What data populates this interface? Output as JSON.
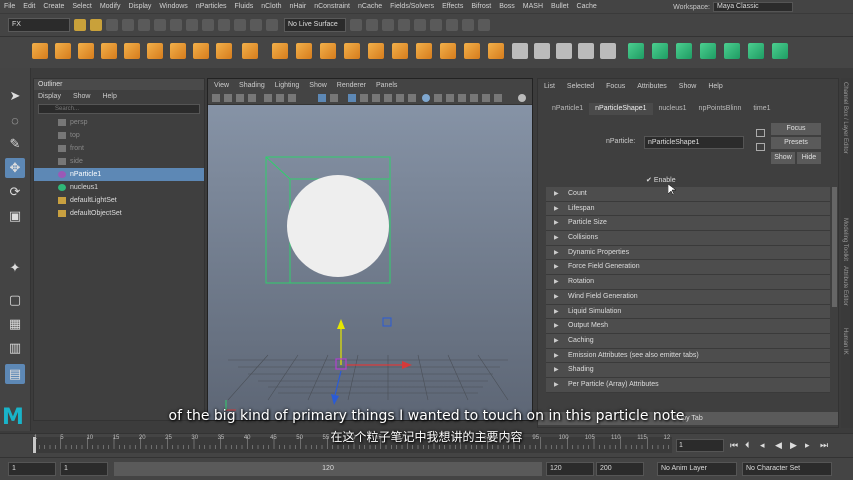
{
  "menubar": {
    "items": [
      "File",
      "Edit",
      "Create",
      "Select",
      "Modify",
      "Display",
      "Windows",
      "nParticles",
      "Fluids",
      "nCloth",
      "nHair",
      "nConstraint",
      "nCache",
      "Fields/Solvers",
      "Effects",
      "Bifrost",
      "Boss",
      "MASH",
      "Bullet",
      "Cache"
    ],
    "workspace_label": "Workspace:",
    "workspace_value": "Maya Classic"
  },
  "statusline": {
    "mode": "FX",
    "live_surface": "No Live Surface"
  },
  "outliner": {
    "title": "Outliner",
    "menu": [
      "Display",
      "Show",
      "Help"
    ],
    "search_placeholder": "Search...",
    "items": [
      {
        "label": "persp",
        "state": "dim"
      },
      {
        "label": "top",
        "state": "dim"
      },
      {
        "label": "front",
        "state": "dim"
      },
      {
        "label": "side",
        "state": "dim"
      },
      {
        "label": "nParticle1",
        "state": "sel"
      },
      {
        "label": "nucleus1",
        "state": "normal"
      },
      {
        "label": "defaultLightSet",
        "state": "normal"
      },
      {
        "label": "defaultObjectSet",
        "state": "normal"
      }
    ]
  },
  "viewport": {
    "menu": [
      "View",
      "Shading",
      "Lighting",
      "Show",
      "Renderer",
      "Panels"
    ]
  },
  "attribute_editor": {
    "menu": [
      "List",
      "Selected",
      "Focus",
      "Attributes",
      "Show",
      "Help"
    ],
    "tabs": [
      "nParticle1",
      "nParticleShape1",
      "nucleus1",
      "npPointsBlinn",
      "time1"
    ],
    "name_label": "nParticle:",
    "name_value": "nParticleShape1",
    "focus": "Focus",
    "presets": "Presets",
    "show": "Show",
    "hide": "Hide",
    "enable": "Enable",
    "sections": [
      "Count",
      "Lifespan",
      "Particle Size",
      "Collisions",
      "Dynamic Properties",
      "Force Field Generation",
      "Rotation",
      "Wind Field Generation",
      "Liquid Simulation",
      "Output Mesh",
      "Caching",
      "Emission Attributes (see also emitter tabs)",
      "Shading",
      "Per Particle (Array) Attributes"
    ],
    "copy_tab": "Copy Tab"
  },
  "sidetabs": [
    "Channel Box / Layer Editor",
    "Modeling Toolkit",
    "Attribute Editor",
    "Human IK"
  ],
  "timeslider": {
    "ticks": [
      "1",
      "5",
      "10",
      "15",
      "20",
      "25",
      "30",
      "35",
      "40",
      "45",
      "50",
      "55",
      "60",
      "65",
      "70",
      "75",
      "80",
      "85",
      "90",
      "95",
      "100",
      "105",
      "110",
      "115",
      "12"
    ],
    "current_frame": "1"
  },
  "rangeslider": {
    "start": "1",
    "start2": "1",
    "range_mid": "120",
    "end": "120",
    "end2": "200",
    "anim_layer": "No Anim Layer",
    "character_set": "No Character Set"
  },
  "logo": "M",
  "subtitles": {
    "en": "of the big kind of primary things I wanted to touch on in this particle note",
    "zh": "在这个粒子笔记中我想讲的主要内容"
  },
  "colors": {
    "selection": "#5d88b5",
    "accent_orange": "#e59a33",
    "accent_green": "#2fb878",
    "logo": "#19b4c9"
  }
}
